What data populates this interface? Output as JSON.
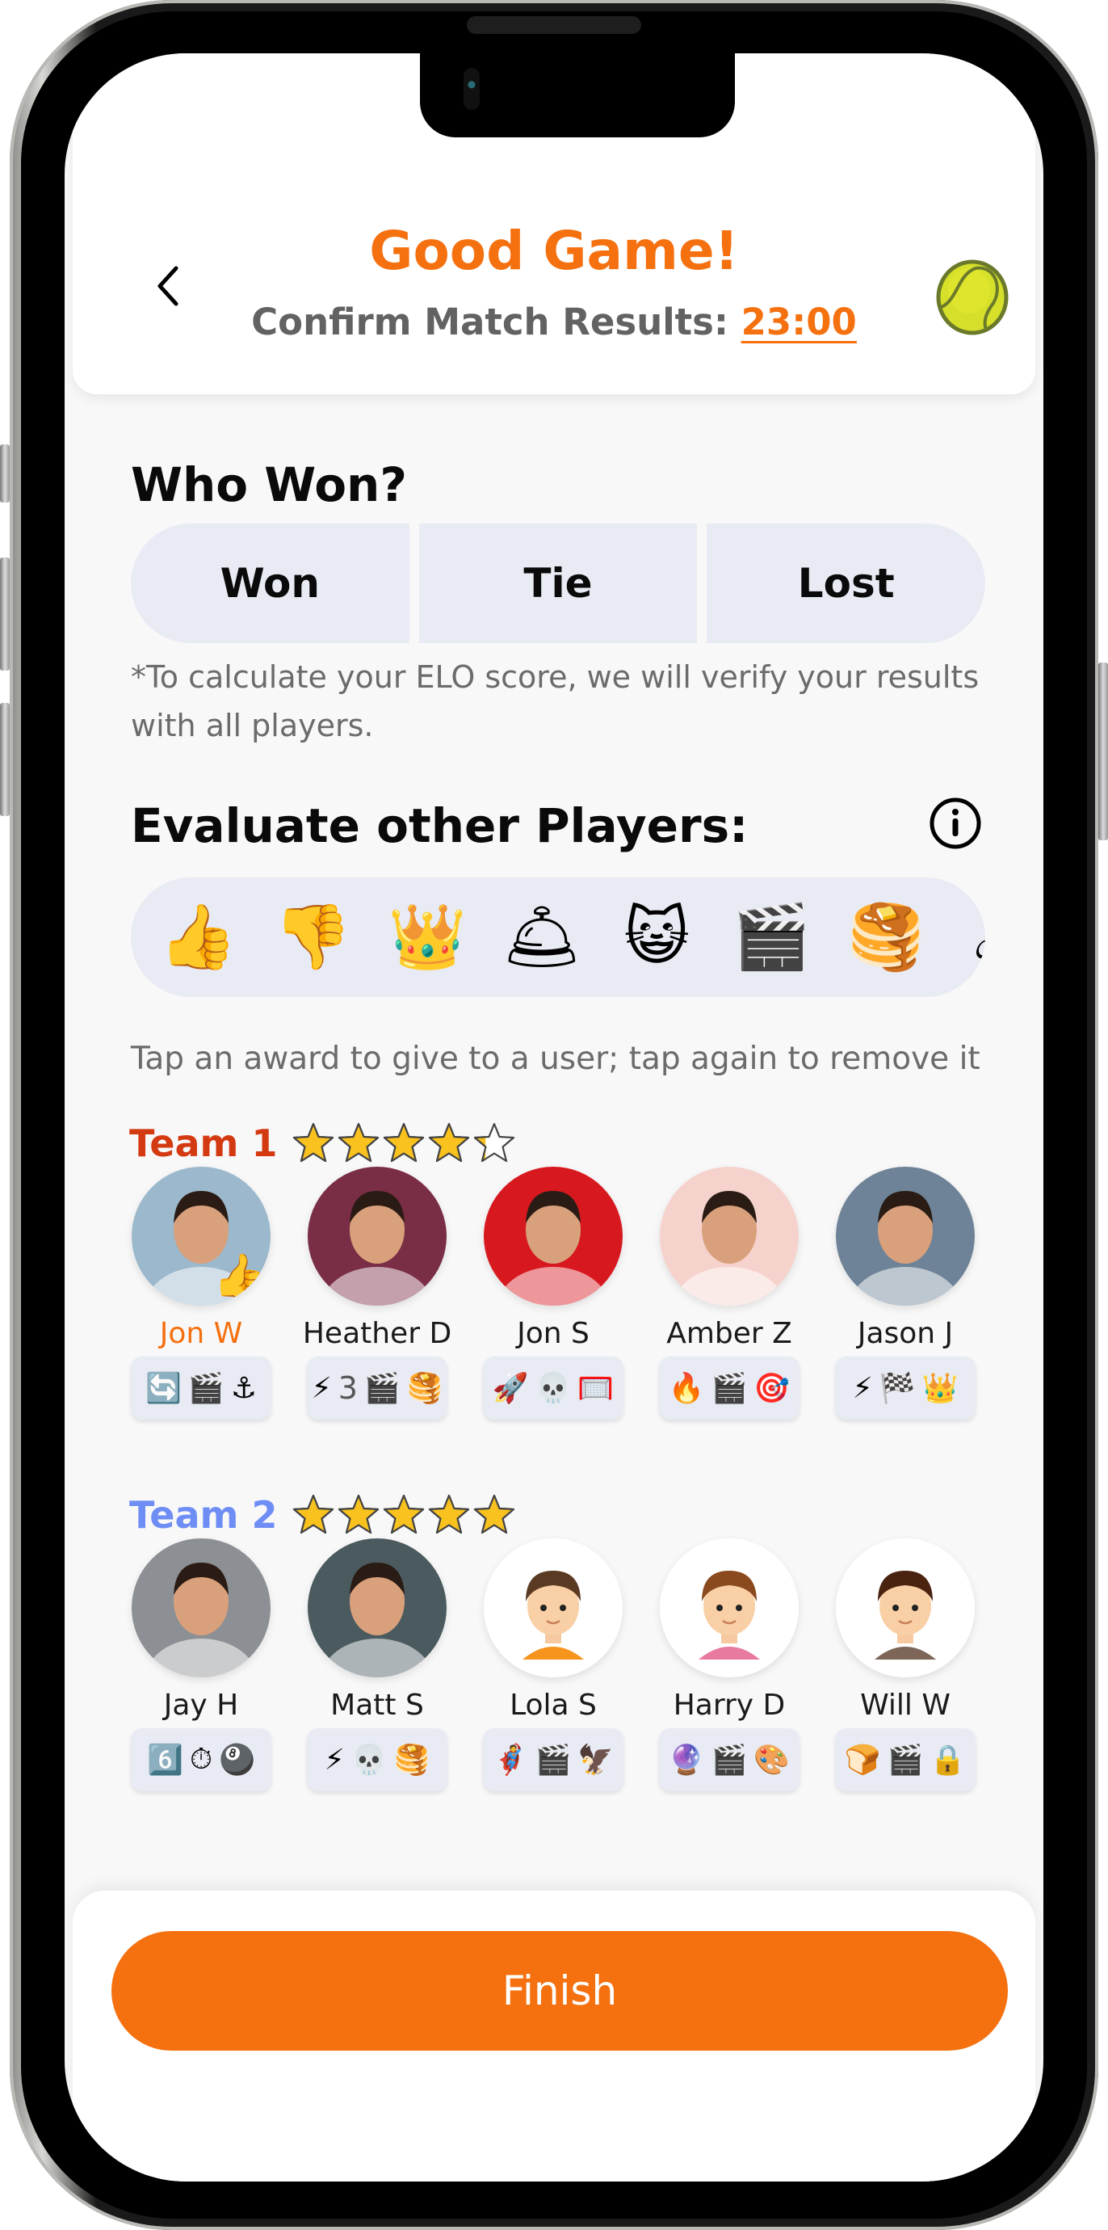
{
  "header": {
    "title": "Good Game!",
    "subtitle_label": "Confirm Match Results: ",
    "timer": "23:00",
    "back_icon": "chevron-left-icon",
    "sport_icon": "tennis-ball-icon"
  },
  "who_won": {
    "title": "Who Won?",
    "options": [
      "Won",
      "Tie",
      "Lost"
    ],
    "note": "*To calculate your ELO score, we will verify your results with all players."
  },
  "evaluate": {
    "title": "Evaluate other Players:",
    "info_icon": "info-icon",
    "awards": [
      {
        "name": "thumbs-up",
        "glyph": "👍"
      },
      {
        "name": "thumbs-down",
        "glyph": "👎"
      },
      {
        "name": "crown",
        "glyph": "👑"
      },
      {
        "name": "serving-cloche",
        "glyph": "🛎"
      },
      {
        "name": "cool-cat",
        "glyph": "😺"
      },
      {
        "name": "clapperboard",
        "glyph": "🎬"
      },
      {
        "name": "pancakes",
        "glyph": "🥞"
      },
      {
        "name": "flaming-ball",
        "glyph": "☄"
      }
    ],
    "hint": "Tap an award to give to a user; tap again to remove it"
  },
  "teams": [
    {
      "name": "Team 1",
      "color": "#d43a12",
      "rating": 4.3,
      "max_rating": 5,
      "players": [
        {
          "name": "Jon W",
          "is_me": true,
          "avatar": "photo",
          "tone": "#9cb8cc",
          "overlay": "👍",
          "badges": [
            {
              "glyph": "🔄"
            },
            {
              "glyph": "🎬"
            },
            {
              "glyph": "⚓"
            }
          ]
        },
        {
          "name": "Heather D",
          "is_me": false,
          "avatar": "photo",
          "tone": "#7a2e45",
          "badges": [
            {
              "glyph": "⚡",
              "count": "3"
            },
            {
              "glyph": "🎬"
            },
            {
              "glyph": "🥞"
            }
          ]
        },
        {
          "name": "Jon S",
          "is_me": false,
          "avatar": "photo",
          "tone": "#d7191f",
          "badges": [
            {
              "glyph": "🚀"
            },
            {
              "glyph": "💀"
            },
            {
              "glyph": "🥅"
            }
          ]
        },
        {
          "name": "Amber Z",
          "is_me": false,
          "avatar": "photo",
          "tone": "#f6d2cc",
          "badges": [
            {
              "glyph": "🔥"
            },
            {
              "glyph": "🎬"
            },
            {
              "glyph": "🎯"
            }
          ]
        },
        {
          "name": "Jason J",
          "is_me": false,
          "avatar": "photo",
          "tone": "#6e8397",
          "badges": [
            {
              "glyph": "⚡"
            },
            {
              "glyph": "🏁"
            },
            {
              "glyph": "👑"
            }
          ]
        }
      ]
    },
    {
      "name": "Team 2",
      "color": "#6e8ef5",
      "rating": 4.9,
      "max_rating": 5,
      "players": [
        {
          "name": "Jay H",
          "is_me": false,
          "avatar": "photo",
          "tone": "#8c8f93",
          "badges": [
            {
              "glyph": "6️⃣"
            },
            {
              "glyph": "⏱"
            },
            {
              "glyph": "🎱"
            }
          ]
        },
        {
          "name": "Matt S",
          "is_me": false,
          "avatar": "photo",
          "tone": "#4a5a5f",
          "badges": [
            {
              "glyph": "⚡"
            },
            {
              "glyph": "💀"
            },
            {
              "glyph": "🥞"
            }
          ]
        },
        {
          "name": "Lola S",
          "is_me": false,
          "avatar": "cartoon",
          "hair": "#5a3a22",
          "shirt": "#f7941d",
          "badges": [
            {
              "glyph": "🦸"
            },
            {
              "glyph": "🎬"
            },
            {
              "glyph": "🦅"
            }
          ]
        },
        {
          "name": "Harry D",
          "is_me": false,
          "avatar": "cartoon",
          "hair": "#8a4a1e",
          "shirt": "#e87aa0",
          "badges": [
            {
              "glyph": "🔮"
            },
            {
              "glyph": "🎬"
            },
            {
              "glyph": "🎨"
            }
          ]
        },
        {
          "name": "Will W",
          "is_me": false,
          "avatar": "cartoon",
          "hair": "#4a2210",
          "shirt": "#7d6558",
          "badges": [
            {
              "glyph": "🍞"
            },
            {
              "glyph": "🎬"
            },
            {
              "glyph": "🔒"
            }
          ]
        }
      ]
    }
  ],
  "footer": {
    "finish_label": "Finish"
  },
  "colors": {
    "accent": "#f5700f",
    "chip_bg": "#e8ebf3",
    "muted_text": "#6b6b6b"
  }
}
